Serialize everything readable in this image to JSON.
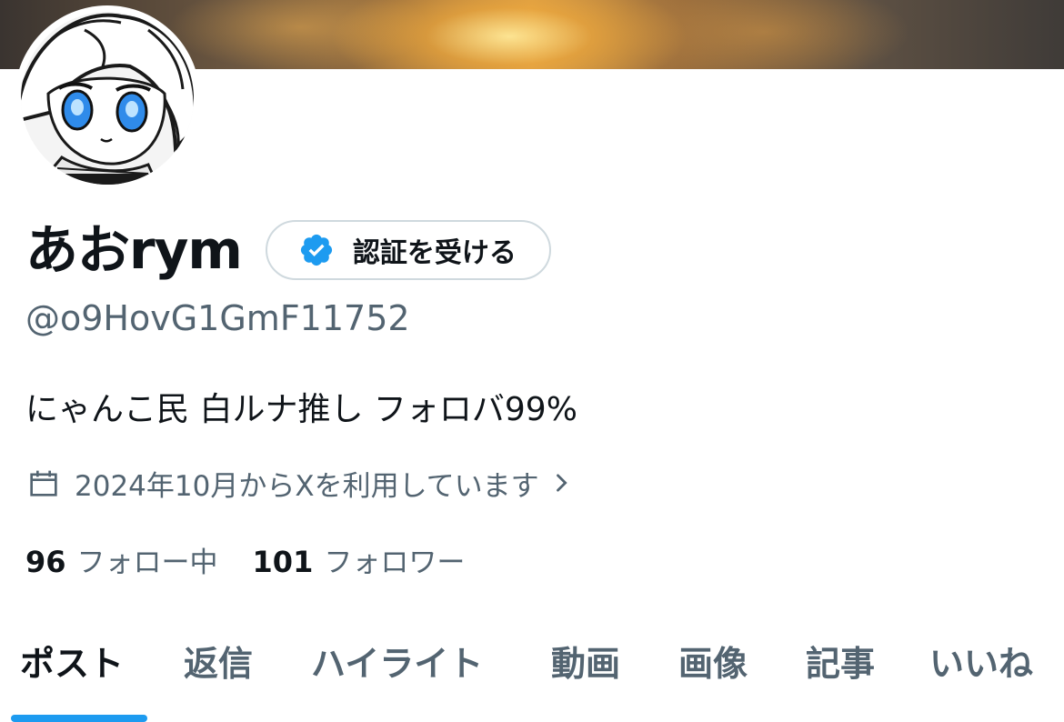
{
  "profile": {
    "display_name": "あおrym",
    "handle": "@o9HovG1GmF11752",
    "bio": "にゃんこ民 白ルナ推し フォロバ99%",
    "joined": "2024年10月からXを利用しています",
    "verify_button": "認証を受ける"
  },
  "stats": {
    "following_count": "96",
    "following_label": "フォロー中",
    "followers_count": "101",
    "followers_label": "フォロワー"
  },
  "tabs": [
    {
      "label": "ポスト",
      "active": true
    },
    {
      "label": "返信",
      "active": false
    },
    {
      "label": "ハイライト",
      "active": false
    },
    {
      "label": "動画",
      "active": false
    },
    {
      "label": "画像",
      "active": false
    },
    {
      "label": "記事",
      "active": false
    },
    {
      "label": "いいね",
      "active": false
    }
  ],
  "colors": {
    "accent": "#1d9bf0",
    "text_primary": "#0f1419",
    "text_secondary": "#536471",
    "border": "#cfd9de"
  },
  "icons": {
    "verify": "verified-badge-icon",
    "joined": "calendar-icon",
    "joined_more": "chevron-right-icon"
  }
}
